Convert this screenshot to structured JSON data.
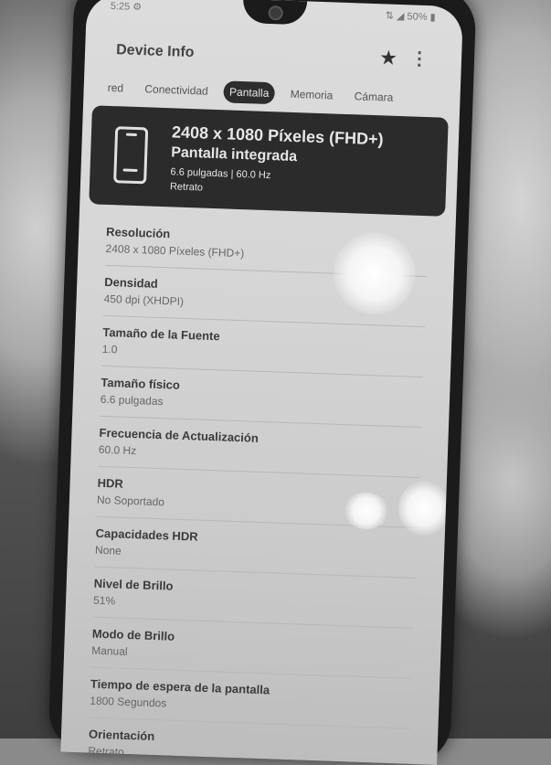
{
  "status_bar": {
    "time": "5:25 ⚙",
    "right": "⇅ ◢ 50% ▮"
  },
  "app": {
    "title": "Device Info"
  },
  "icons": {
    "star": "star-icon",
    "more": "more-vert-icon",
    "phone": "smartphone-icon"
  },
  "tabs": [
    {
      "label": "red",
      "active": false
    },
    {
      "label": "Conectividad",
      "active": false
    },
    {
      "label": "Pantalla",
      "active": true
    },
    {
      "label": "Memoria",
      "active": false
    },
    {
      "label": "Cámara",
      "active": false
    }
  ],
  "hero": {
    "resolution": "2408 x 1080 Píxeles (FHD+)",
    "type": "Pantalla integrada",
    "detail": "6.6 pulgadas | 60.0 Hz",
    "orientation": "Retrato"
  },
  "items": [
    {
      "label": "Resolución",
      "value": "2408 x 1080 Píxeles (FHD+)"
    },
    {
      "label": "Densidad",
      "value": "450 dpi (XHDPI)"
    },
    {
      "label": "Tamaño de la Fuente",
      "value": "1.0"
    },
    {
      "label": "Tamaño físico",
      "value": "6.6 pulgadas"
    },
    {
      "label": "Frecuencia de Actualización",
      "value": "60.0 Hz"
    },
    {
      "label": "HDR",
      "value": "No Soportado"
    },
    {
      "label": "Capacidades HDR",
      "value": "None"
    },
    {
      "label": "Nivel de Brillo",
      "value": "51%"
    },
    {
      "label": "Modo de Brillo",
      "value": "Manual"
    },
    {
      "label": "Tiempo de espera de la pantalla",
      "value": "1800 Segundos"
    },
    {
      "label": "Orientación",
      "value": "Retrato"
    }
  ]
}
